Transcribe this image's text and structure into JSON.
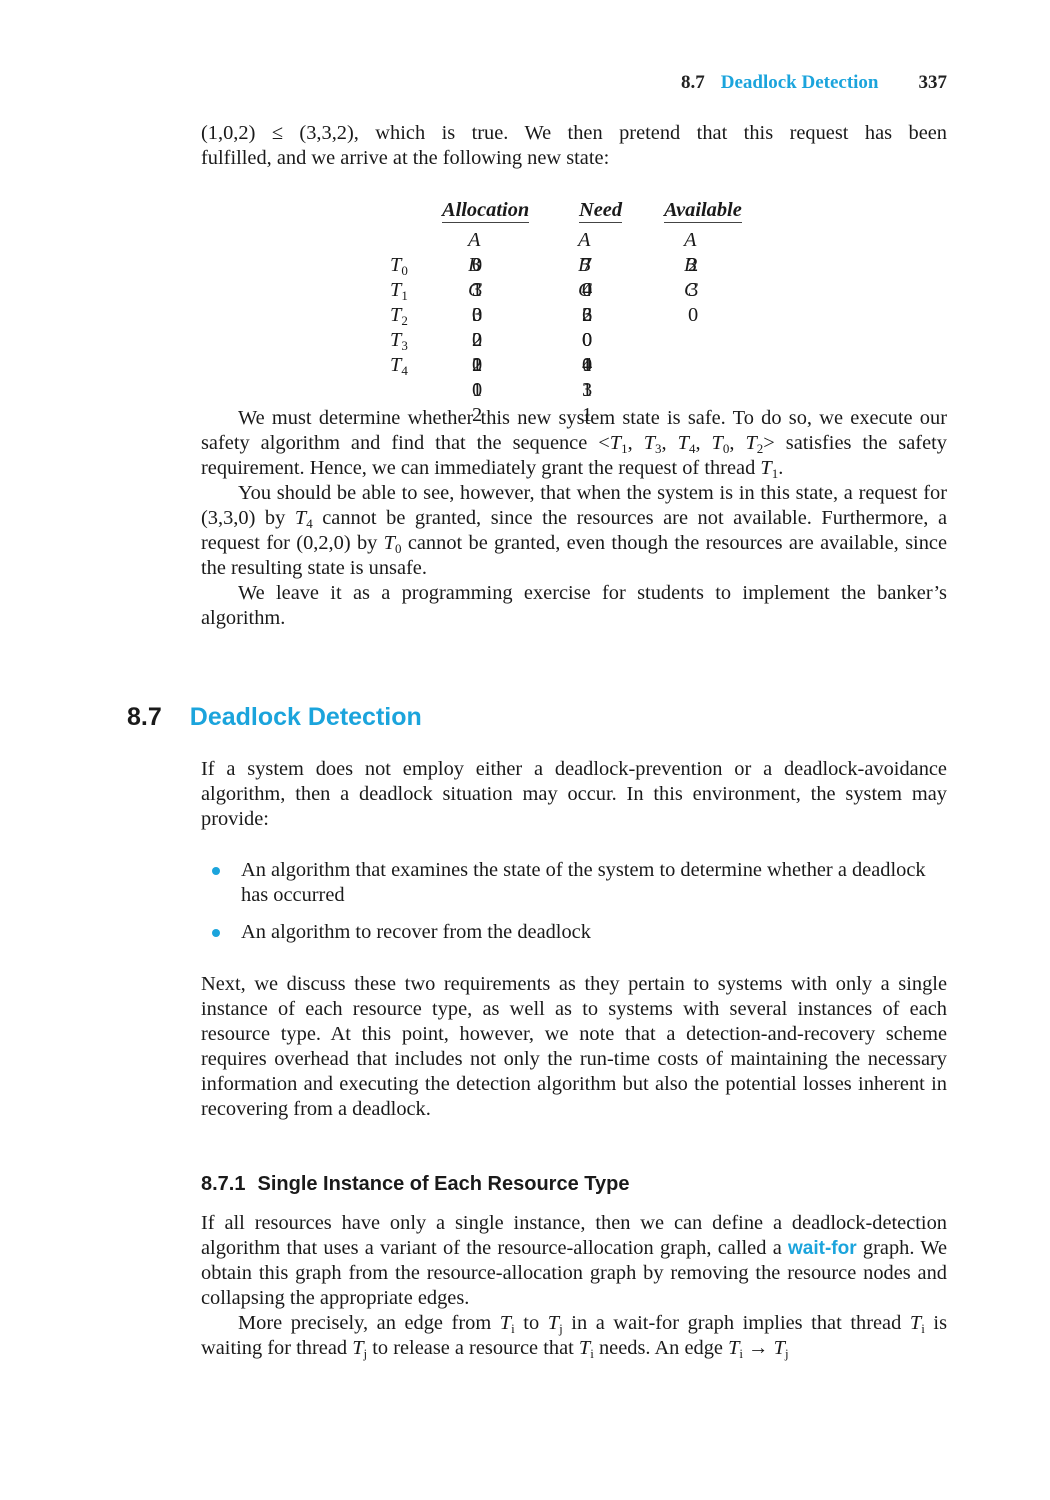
{
  "running_head": {
    "section_number": "8.7",
    "section_title": "Deadlock Detection",
    "page_number": "337"
  },
  "intro": {
    "p1_a": "(1,0,2) ≤ (3,3,2), which is true. We then pretend that this request has been",
    "p1_b": "fulfilled, and we arrive at the following new state:"
  },
  "state_table": {
    "headers": [
      "Allocation",
      "Need",
      "Available"
    ],
    "sub_header": "A B C",
    "rows": [
      {
        "thread": "T",
        "sub": "0",
        "allocation": "0 1 0",
        "need": "7 4 3",
        "available": "2 3 0"
      },
      {
        "thread": "T",
        "sub": "1",
        "allocation": "3 0 2",
        "need": "0 2 0",
        "available": ""
      },
      {
        "thread": "T",
        "sub": "2",
        "allocation": "3 0 2",
        "need": "6 0 0",
        "available": ""
      },
      {
        "thread": "T",
        "sub": "3",
        "allocation": "2 1 1",
        "need": "0 1 1",
        "available": ""
      },
      {
        "thread": "T",
        "sub": "4",
        "allocation": "0 0 2",
        "need": "4 3 1",
        "available": ""
      }
    ]
  },
  "paragraphs": {
    "safe_1": "We must determine whether this new system state is safe. To do so, we execute our safety algorithm and find that the sequence <",
    "safe_seq": [
      {
        "t": "T",
        "s": "1"
      },
      {
        "t": "T",
        "s": "3"
      },
      {
        "t": "T",
        "s": "4"
      },
      {
        "t": "T",
        "s": "0"
      },
      {
        "t": "T",
        "s": "2"
      }
    ],
    "safe_2": "> satisfies the safety requirement. Hence, we can immediately grant the request of thread ",
    "safe_thread_sub": "1",
    "see_1": "You should be able to see, however, that when the system is in this state, a request for (3,3,0) by ",
    "see_t4_sub": "4",
    "see_2": " cannot be granted, since the resources are not available. Furthermore, a request for (0,2,0) by ",
    "see_t0_sub": "0",
    "see_3": " cannot be granted, even though the resources are available, since the resulting state is unsafe.",
    "leave": "We leave it as a programming exercise for students to implement the banker’s algorithm."
  },
  "section": {
    "number": "8.7",
    "title": "Deadlock Detection",
    "intro": "If a system does not employ either a deadlock-prevention or a deadlock-avoidance algorithm, then a deadlock situation may occur. In this environment, the system may provide:",
    "bullets": [
      "An algorithm that examines the state of the system to determine whether a deadlock has occurred",
      "An algorithm to recover from the deadlock"
    ],
    "next": "Next, we discuss these two requirements as they pertain to systems with only a single instance of each resource type, as well as to systems with several instances of each resource type. At this point, however, we note that a detection-and-recovery scheme requires overhead that includes not only the run-time costs of maintaining the necessary information and executing the detection algorithm but also the potential losses inherent in recovering from a deadlock."
  },
  "subsection": {
    "number": "8.7.1",
    "title": "Single Instance of Each Resource Type",
    "p1_a": "If all resources have only a single instance, then we can define a deadlock-detection algorithm that uses a variant of the resource-allocation graph, called a ",
    "term": "wait-for",
    "p1_b": " graph. We obtain this graph from the resource-allocation graph by removing the resource nodes and collapsing the appropriate edges.",
    "p2_a": "More precisely, an edge from ",
    "p2_b": " to ",
    "p2_c": " in a wait-for graph implies that thread ",
    "p2_d": " is waiting for thread ",
    "p2_e": " to release a resource that ",
    "p2_f": " needs. An edge ",
    "arrow": "→",
    "T": "T",
    "i": "i",
    "j": "j"
  }
}
